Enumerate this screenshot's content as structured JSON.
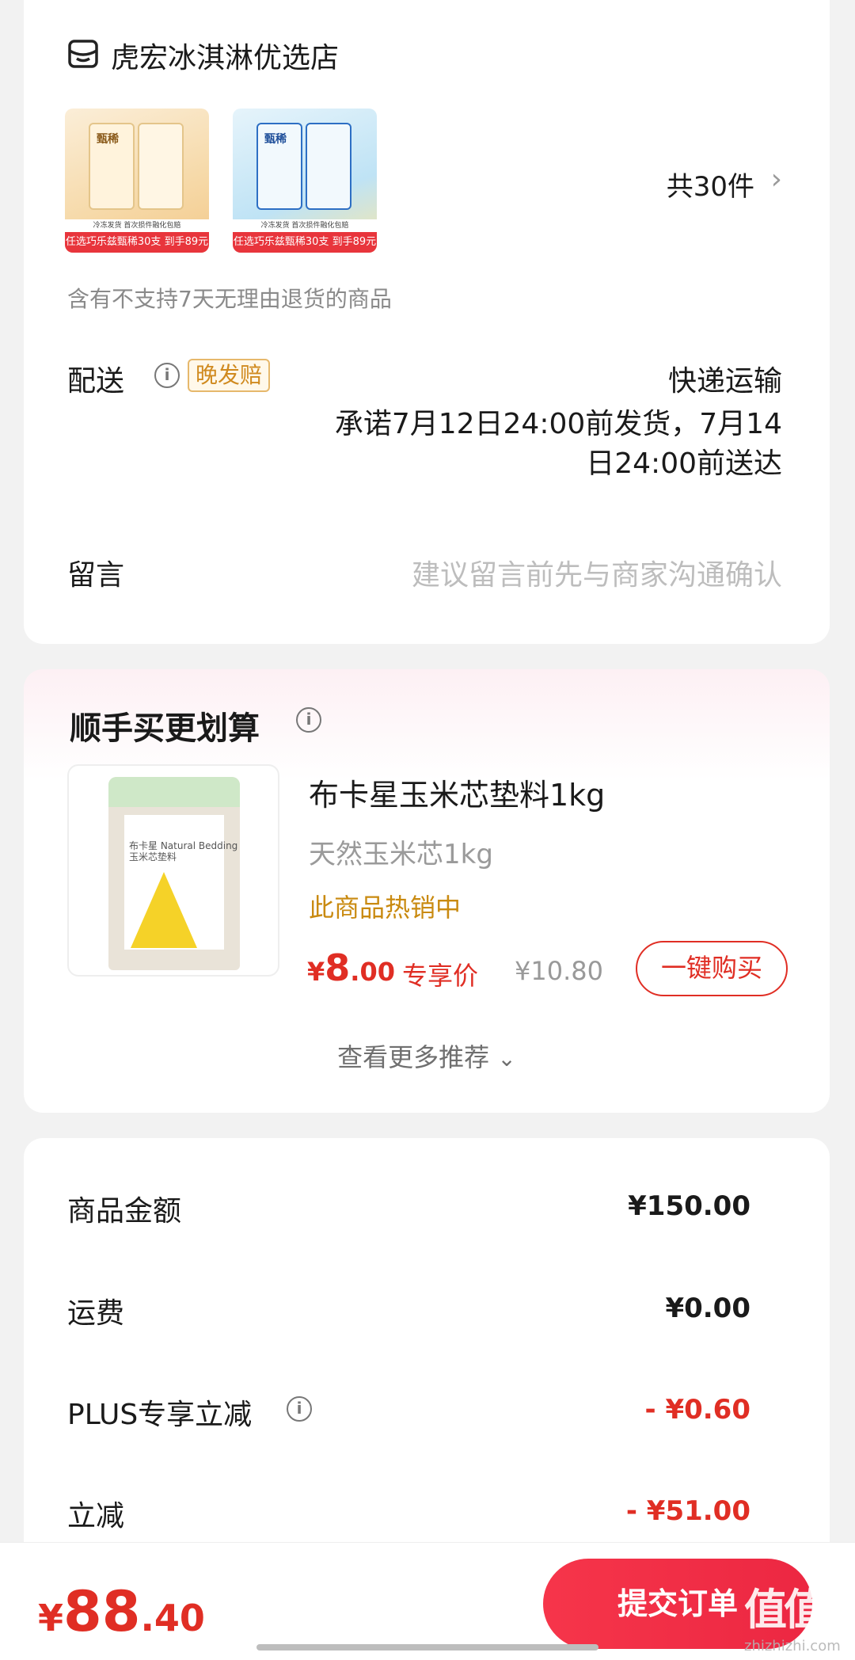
{
  "store": {
    "name": "虎宏冰淇淋优选店",
    "product_thumbs": [
      {
        "brand": "甄稀",
        "subline": "冷冻发货 首次损件融化包赔",
        "banner": "任选巧乐兹甄稀30支 到手89元"
      },
      {
        "brand": "甄稀",
        "subline": "冷冻发货 首次损件融化包赔",
        "banner": "任选巧乐兹甄稀30支 到手89元"
      }
    ],
    "count_text": "共30件",
    "return_notice": "含有不支持7天无理由退货的商品",
    "delivery": {
      "label": "配送",
      "tag": "晚发赔",
      "method": "快递运输",
      "promise_line1": "承诺7月12日24:00前发货，7月14",
      "promise_line2": "日24:00前送达"
    },
    "message": {
      "label": "留言",
      "placeholder": "建议留言前先与商家沟通确认"
    }
  },
  "recommend": {
    "title": "顺手买更划算",
    "product": {
      "image_text": "布卡星 Natural Bedding 玉米芯垫料",
      "name": "布卡星玉米芯垫料1kg",
      "spec": "天然玉米芯1kg",
      "hot": "此商品热销中",
      "price_symbol": "¥",
      "price_int": "8",
      "price_dec": ".00",
      "price_label": "专享价",
      "original_price": "¥10.80",
      "buy_label": "一键购买"
    },
    "more_label": "查看更多推荐"
  },
  "summary": {
    "rows": [
      {
        "label": "商品金额",
        "value": "¥150.00"
      },
      {
        "label": "运费",
        "value": "¥0.00"
      },
      {
        "label": "PLUS专享立减",
        "value": "- ¥0.60"
      },
      {
        "label": "立减",
        "value": "- ¥51.00"
      }
    ]
  },
  "bottom": {
    "total_symbol": "¥",
    "total_int": "88",
    "total_dec": ".40",
    "submit_label": "提交订单"
  },
  "watermark": {
    "mark": "值值值",
    "site": "zhizhizhi.com"
  },
  "colors": {
    "accent_red": "#e02e24",
    "button_red": "#f6354a",
    "hot_gold": "#c98a10"
  }
}
